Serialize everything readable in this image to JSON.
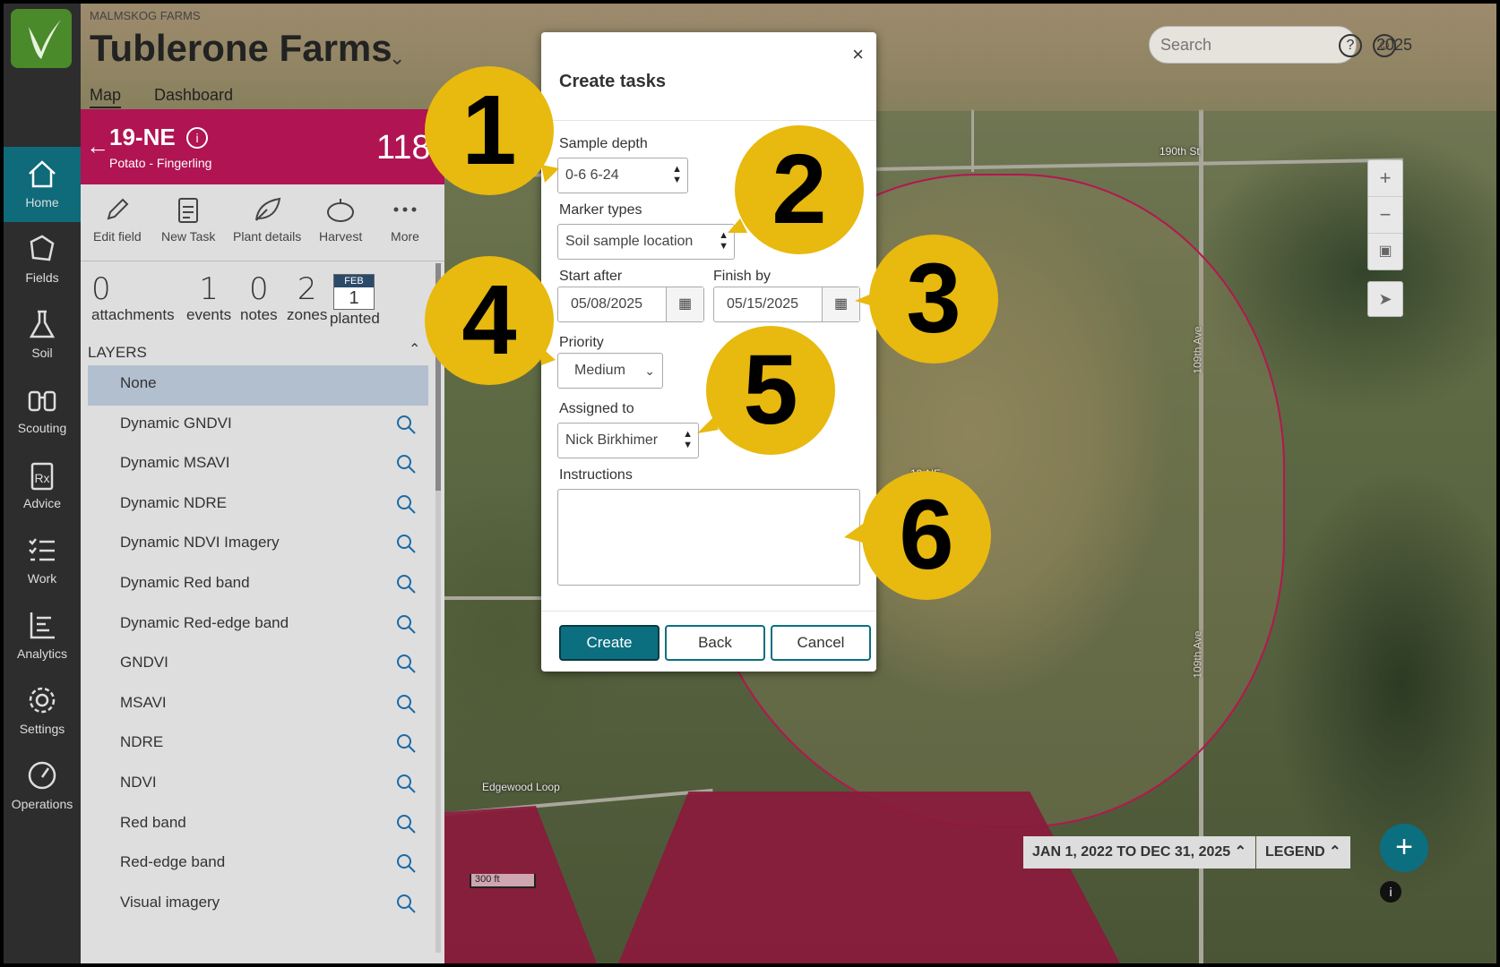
{
  "org_name": "MALMSKOG FARMS",
  "farm_name": "Tublerone Farms",
  "tabs": {
    "map": "Map",
    "dashboard": "Dashboard"
  },
  "search": {
    "placeholder": "Search"
  },
  "year": "2025",
  "nav": [
    {
      "label": "Home",
      "icon": "home-icon"
    },
    {
      "label": "Fields",
      "icon": "fields-icon"
    },
    {
      "label": "Soil",
      "icon": "flask-icon"
    },
    {
      "label": "Scouting",
      "icon": "binoculars-icon"
    },
    {
      "label": "Advice",
      "icon": "prescription-icon"
    },
    {
      "label": "Work",
      "icon": "checklist-icon"
    },
    {
      "label": "Analytics",
      "icon": "chart-icon"
    },
    {
      "label": "Settings",
      "icon": "gear-icon"
    },
    {
      "label": "Operations",
      "icon": "gauge-icon"
    }
  ],
  "field": {
    "name": "19-NE",
    "crop": "Potato - Fingerling",
    "acres": "118a"
  },
  "toolbar": {
    "edit": "Edit field",
    "new_task": "New Task",
    "plant": "Plant details",
    "harvest": "Harvest",
    "more": "More"
  },
  "stats": {
    "attachments": {
      "num": "0",
      "label": "attachments"
    },
    "events": {
      "num": "1",
      "label": "events"
    },
    "notes": {
      "num": "0",
      "label": "notes"
    },
    "zones": {
      "num": "2",
      "label": "zones"
    },
    "planted": {
      "month": "FEB",
      "day": "1",
      "label": "planted"
    }
  },
  "layers": {
    "header": "LAYERS",
    "items": [
      "None",
      "Dynamic GNDVI",
      "Dynamic MSAVI",
      "Dynamic NDRE",
      "Dynamic NDVI Imagery",
      "Dynamic Red band",
      "Dynamic Red-edge band",
      "GNDVI",
      "MSAVI",
      "NDRE",
      "NDVI",
      "Red band",
      "Red-edge band",
      "Visual imagery"
    ]
  },
  "map": {
    "roads": [
      "190th St",
      "109th Ave",
      "109th Ave",
      "Edgewood Loop"
    ],
    "field_label": "19-NE",
    "scale": "300 ft",
    "date_range": "JAN 1, 2022 TO DEC 31, 2025",
    "legend": "LEGEND"
  },
  "modal": {
    "title": "Create tasks",
    "sample_depth": {
      "label": "Sample depth",
      "value": "0-6  6-24"
    },
    "marker_types": {
      "label": "Marker types",
      "value": "Soil sample location"
    },
    "start_after": {
      "label": "Start after",
      "value": "05/08/2025"
    },
    "finish_by": {
      "label": "Finish by",
      "value": "05/15/2025"
    },
    "priority": {
      "label": "Priority",
      "value": "Medium"
    },
    "assigned_to": {
      "label": "Assigned to",
      "value": "Nick Birkhimer"
    },
    "instructions": {
      "label": "Instructions",
      "value": ""
    },
    "buttons": {
      "create": "Create",
      "back": "Back",
      "cancel": "Cancel"
    }
  },
  "callouts": [
    "1",
    "2",
    "3",
    "4",
    "5",
    "6"
  ],
  "colors": {
    "accent": "#0b6f80",
    "field_bar": "#b01452",
    "callout": "#e8b90e"
  }
}
